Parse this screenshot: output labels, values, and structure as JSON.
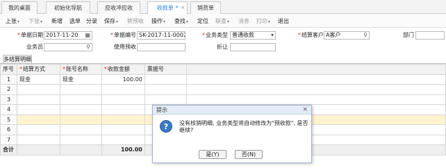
{
  "tabs": [
    {
      "label": "我的桌面",
      "active": false,
      "closable": false
    },
    {
      "label": "初始化导航",
      "active": false,
      "closable": false
    },
    {
      "label": "应收冲应收",
      "active": false,
      "closable": false
    },
    {
      "label": "收款单 *",
      "active": true,
      "closable": true
    },
    {
      "label": "销货单",
      "active": false,
      "closable": false
    }
  ],
  "tab_close_glyph": "×",
  "toolbar": {
    "items": [
      {
        "label": "上张",
        "dropdown": true,
        "enabled": true
      },
      {
        "label": "下张",
        "dropdown": true,
        "enabled": false
      },
      {
        "label": "新增",
        "dropdown": false,
        "enabled": true
      },
      {
        "label": "选单",
        "dropdown": false,
        "enabled": true
      },
      {
        "label": "分录",
        "dropdown": false,
        "enabled": true
      },
      {
        "label": "保存",
        "dropdown": true,
        "enabled": true
      },
      {
        "label": "转预收",
        "dropdown": false,
        "enabled": false
      },
      {
        "label": "操作",
        "dropdown": true,
        "enabled": true
      },
      {
        "label": "查找",
        "dropdown": true,
        "enabled": true
      },
      {
        "label": "定位",
        "dropdown": false,
        "enabled": true
      },
      {
        "label": "联查",
        "dropdown": true,
        "enabled": false
      },
      {
        "label": "消息",
        "dropdown": false,
        "enabled": false
      },
      {
        "label": "打印",
        "dropdown": true,
        "enabled": false
      },
      {
        "label": "退出",
        "dropdown": false,
        "enabled": true
      }
    ],
    "caret": "▾"
  },
  "form": {
    "date_label": "单据日期",
    "date_value": "2017-11-20",
    "bill_no_label": "单据编号",
    "bill_no_value": "SK-2017-11-0002",
    "biz_type_label": "业务类型",
    "biz_type_value": "普通收款",
    "customer_label": "结算客户",
    "customer_value": "A客户",
    "dept_label": "部门",
    "dept_value": "",
    "salesman_label": "业务员",
    "salesman_value": "",
    "prepay_label": "使用预收",
    "prepay_value": "",
    "discount_label": "折让",
    "discount_value": ""
  },
  "subtab": {
    "label": "多结算明细"
  },
  "grid": {
    "headers": [
      "序号",
      "结算方式",
      "账号名称",
      "收款金额",
      "票据号"
    ],
    "required_headers": [
      false,
      true,
      true,
      true,
      false
    ],
    "rows": [
      {
        "no": "1",
        "method": "现金",
        "account": "现金",
        "amount": "100.00",
        "ticket": ""
      },
      {
        "no": "2",
        "method": "",
        "account": "",
        "amount": "",
        "ticket": ""
      },
      {
        "no": "3",
        "method": "",
        "account": "",
        "amount": "",
        "ticket": ""
      },
      {
        "no": "4",
        "method": "",
        "account": "",
        "amount": "",
        "ticket": ""
      },
      {
        "no": "5",
        "method": "",
        "account": "",
        "amount": "",
        "ticket": ""
      },
      {
        "no": "6",
        "method": "",
        "account": "",
        "amount": "",
        "ticket": ""
      },
      {
        "no": "7",
        "method": "",
        "account": "",
        "amount": "",
        "ticket": ""
      }
    ],
    "highlight_row_index": 4,
    "total_label": "合计",
    "total_amount": "100.00"
  },
  "dialog": {
    "title": "提示",
    "close_glyph": "×",
    "icon_glyph": "?",
    "message": "没有核销明细, 业务类型将自动修改为\"预收款\", 是否继续?",
    "yes_label": "是(Y)",
    "no_label": "否(N)"
  },
  "icons": {
    "calendar": "calendar-icon",
    "search": "search-icon",
    "dropdown": "dropdown-arrow-icon"
  },
  "colors": {
    "required": "#d22222",
    "active_tab_text": "#2a82d8",
    "highlight_row": "#fff3cf",
    "dialog_header": "#e4ecf5"
  }
}
